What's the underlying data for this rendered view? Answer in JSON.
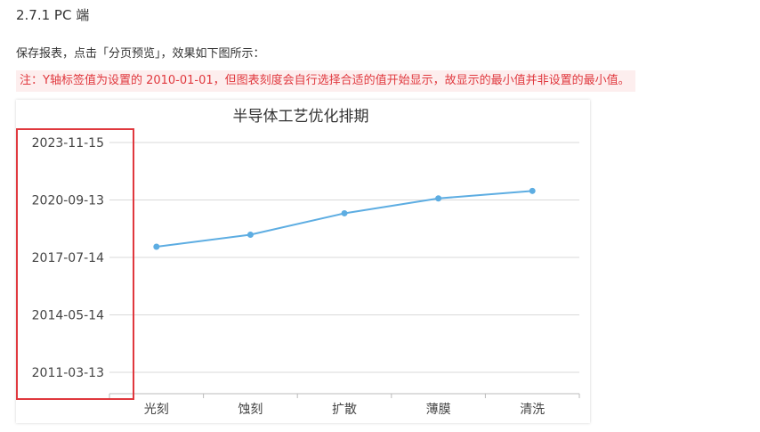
{
  "section_title": "2.7.1 PC 端",
  "description": "保存报表，点击「分页预览」，效果如下图所示：",
  "note": "注：Y轴标签值为设置的 2010-01-01，但图表刻度会自行选择合适的值开始显示，故显示的最小值并非设置的最小值。",
  "colors": {
    "line": "#5dade2",
    "grid": "#d9d9d9",
    "highlight_frame": "#e0383e",
    "note_text": "#e0383e",
    "note_bg": "#fdeeee"
  },
  "chart_data": {
    "type": "line",
    "title": "半导体工艺优化排期",
    "categories": [
      "光刻",
      "蚀刻",
      "扩散",
      "薄膜",
      "清洗"
    ],
    "values": [
      "2018-02-15",
      "2018-10-15",
      "2019-12-20",
      "2020-10-15",
      "2021-03-15"
    ],
    "y_ticks": [
      "2011-03-13",
      "2014-05-14",
      "2017-07-14",
      "2020-09-13",
      "2023-11-15"
    ],
    "ylim": [
      "2010-01-01",
      "2023-11-15"
    ],
    "grid": true,
    "legend": "none"
  }
}
